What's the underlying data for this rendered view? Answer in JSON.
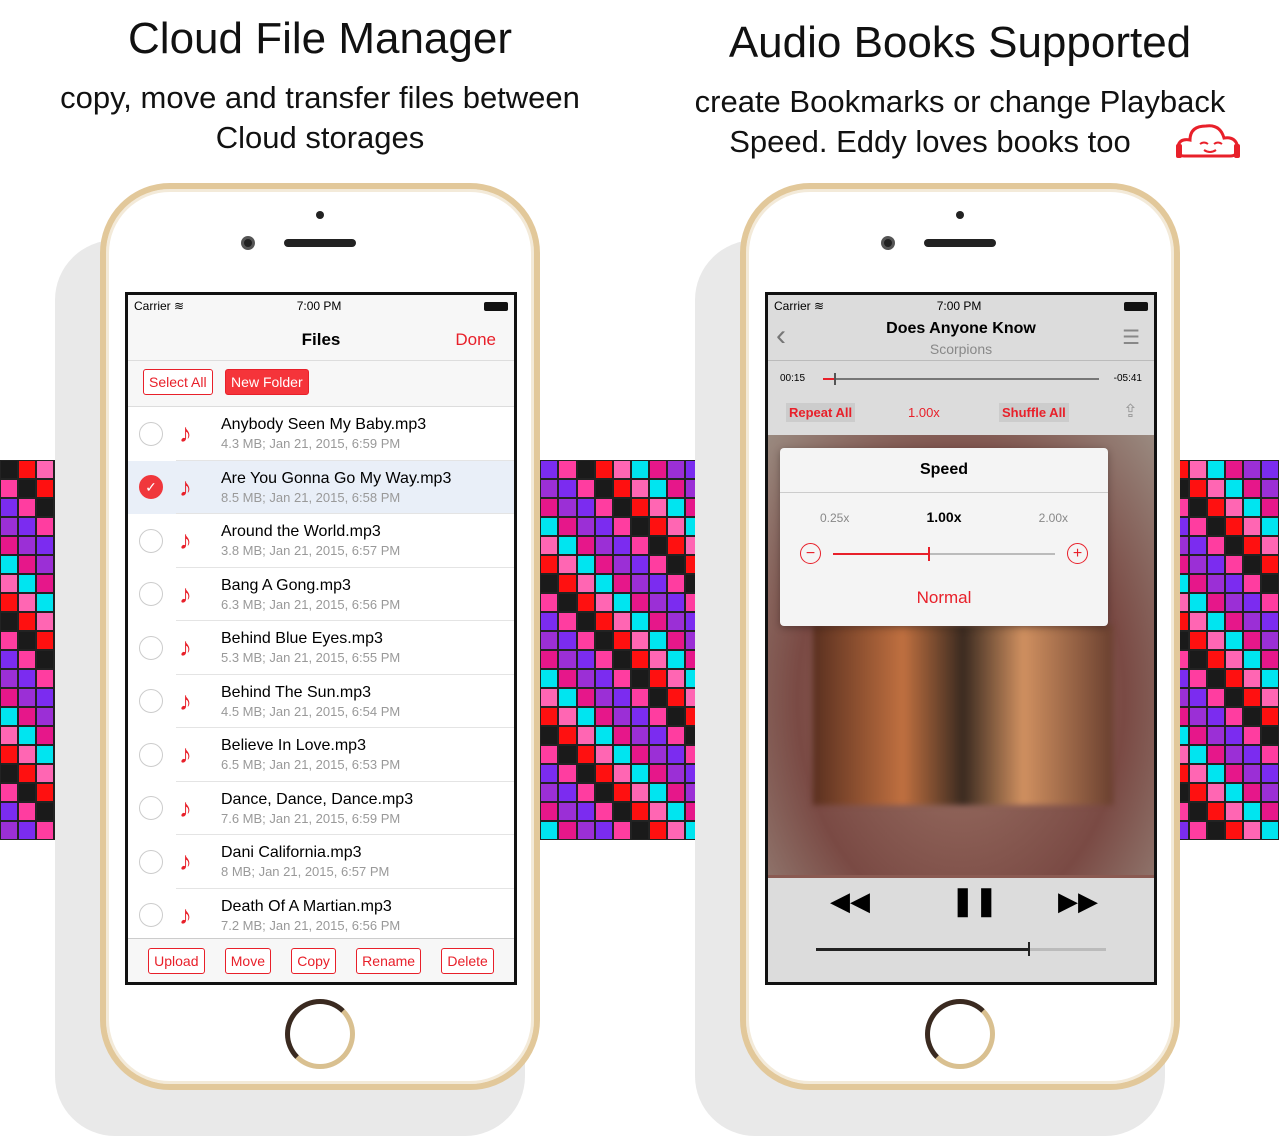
{
  "left_panel": {
    "title": "Cloud File Manager",
    "subtitle_line1": "copy, move and transfer files between",
    "subtitle_line2": "Cloud storages"
  },
  "right_panel": {
    "title": "Audio Books Supported",
    "subtitle_line1": "create Bookmarks or change Playback",
    "subtitle_line2": "Speed. Eddy loves books too"
  },
  "colors": {
    "accent": "#e8202a",
    "tiles": [
      "#e6178a",
      "#9b2fd6",
      "#ff66b3",
      "#00e5f0",
      "#1a1a1a",
      "#ff1010",
      "#7b2cf0",
      "#ff3da0"
    ]
  },
  "status": {
    "carrier": "Carrier",
    "time": "7:00 PM"
  },
  "files": {
    "title": "Files",
    "done": "Done",
    "select_all": "Select All",
    "new_folder": "New Folder",
    "items": [
      {
        "name": "Anybody Seen My Baby.mp3",
        "meta": "4.3 MB; Jan 21, 2015, 6:59 PM",
        "selected": false
      },
      {
        "name": "Are You Gonna Go My Way.mp3",
        "meta": "8.5 MB; Jan 21, 2015, 6:58 PM",
        "selected": true
      },
      {
        "name": "Around the World.mp3",
        "meta": "3.8 MB; Jan 21, 2015, 6:57 PM",
        "selected": false
      },
      {
        "name": "Bang A Gong.mp3",
        "meta": "6.3 MB; Jan 21, 2015, 6:56 PM",
        "selected": false
      },
      {
        "name": "Behind Blue Eyes.mp3",
        "meta": "5.3 MB; Jan 21, 2015, 6:55 PM",
        "selected": false
      },
      {
        "name": "Behind The Sun.mp3",
        "meta": "4.5 MB; Jan 21, 2015, 6:54 PM",
        "selected": false
      },
      {
        "name": "Believe In Love.mp3",
        "meta": "6.5 MB; Jan 21, 2015, 6:53 PM",
        "selected": false
      },
      {
        "name": "Dance, Dance, Dance.mp3",
        "meta": "7.6 MB; Jan 21, 2015, 6:59 PM",
        "selected": false
      },
      {
        "name": "Dani California.mp3",
        "meta": "8 MB; Jan 21, 2015, 6:57 PM",
        "selected": false
      },
      {
        "name": "Death Of A Martian.mp3",
        "meta": "7.2 MB; Jan 21, 2015, 6:56 PM",
        "selected": false
      }
    ],
    "toolbar": [
      "Upload",
      "Move",
      "Copy",
      "Rename",
      "Delete"
    ]
  },
  "player": {
    "song": "Does Anyone Know",
    "artist": "Scorpions",
    "elapsed": "00:15",
    "remaining": "-05:41",
    "progress_fraction": 0.04,
    "repeat": "Repeat All",
    "speed": "1.00x",
    "shuffle": "Shuffle All",
    "popover": {
      "title": "Speed",
      "min": "0.25x",
      "current": "1.00x",
      "max": "2.00x",
      "speed_fraction": 0.43,
      "normal": "Normal"
    },
    "volume_fraction": 0.73
  }
}
